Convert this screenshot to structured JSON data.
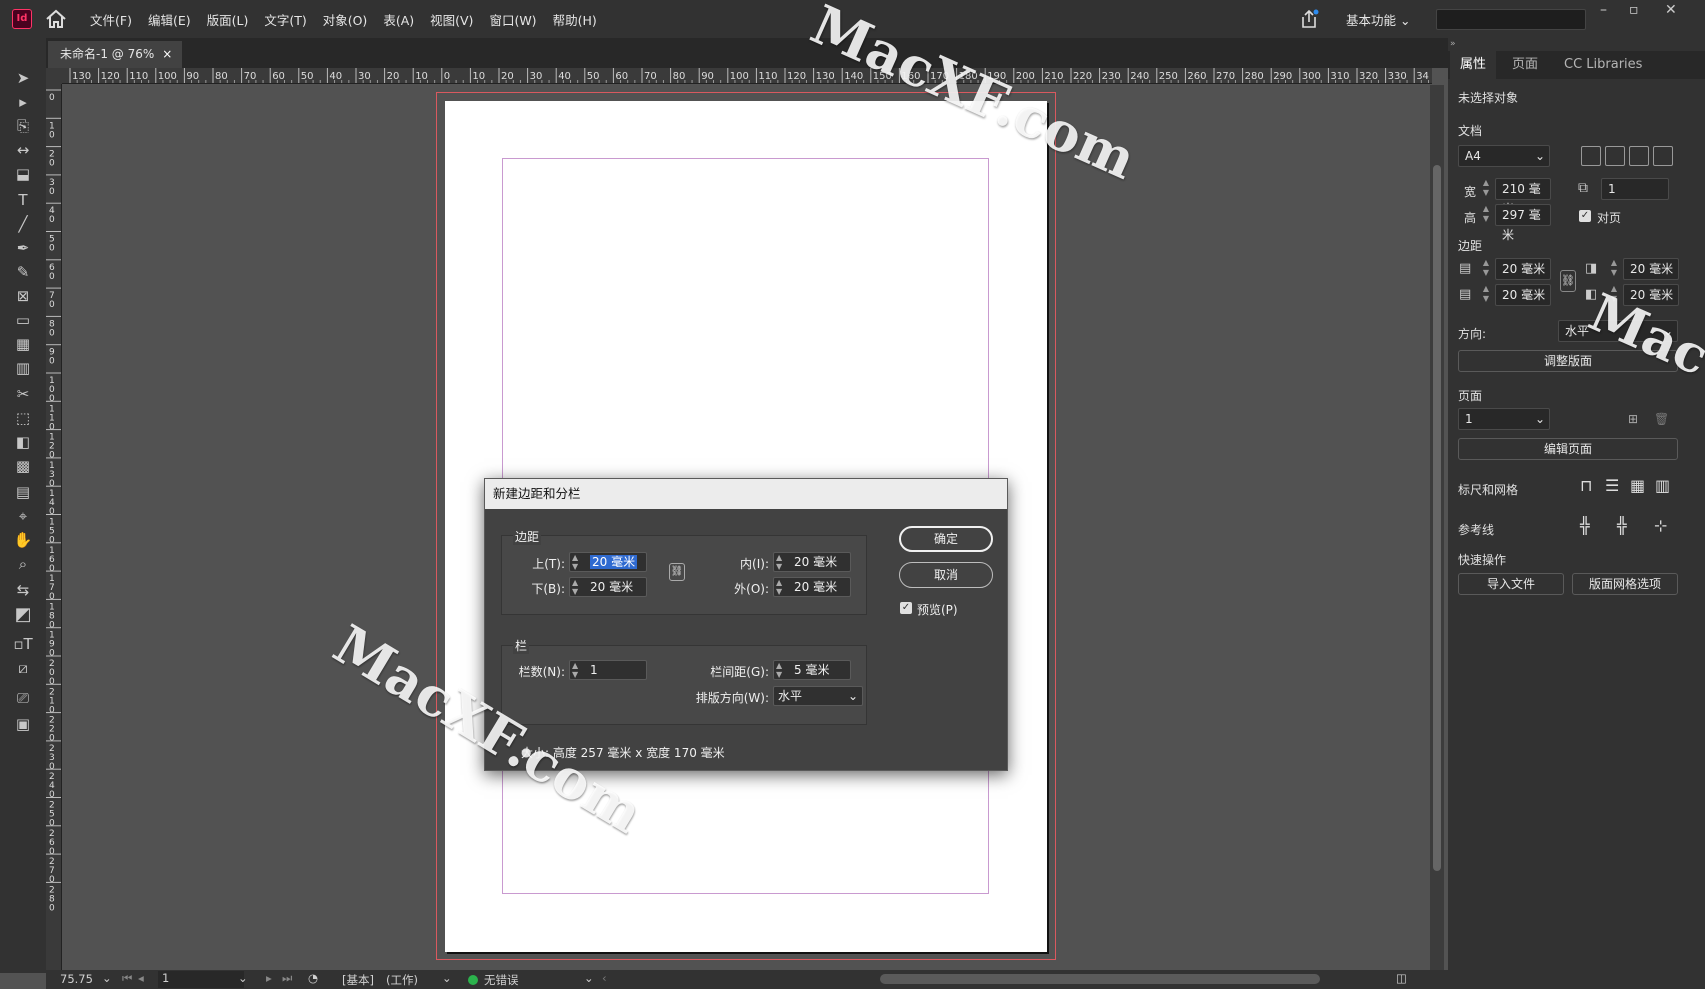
{
  "app": {
    "icon_label": "Id",
    "menu": [
      "文件(F)",
      "编辑(E)",
      "版面(L)",
      "文字(T)",
      "对象(O)",
      "表(A)",
      "视图(V)",
      "窗口(W)",
      "帮助(H)"
    ],
    "workspace": "基本功能"
  },
  "document": {
    "tab_title": "未命名-1 @ 76%",
    "close_glyph": "×"
  },
  "rulers": {
    "horizontal": [
      "130",
      "120",
      "110",
      "100",
      "90",
      "80",
      "70",
      "60",
      "50",
      "40",
      "30",
      "20",
      "10",
      "0",
      "10",
      "20",
      "30",
      "40",
      "50",
      "60",
      "70",
      "80",
      "90",
      "100",
      "110",
      "120",
      "130",
      "140",
      "150",
      "160",
      "170",
      "180",
      "190",
      "200",
      "210",
      "220",
      "230",
      "240",
      "250",
      "260",
      "270",
      "280",
      "290",
      "300",
      "310",
      "320",
      "330",
      "34"
    ],
    "vertical": [
      "0",
      "10",
      "20",
      "30",
      "40",
      "50",
      "60",
      "70",
      "80",
      "90",
      "100",
      "110",
      "120",
      "130",
      "140",
      "150",
      "160",
      "170",
      "180",
      "190",
      "200",
      "210",
      "220",
      "230",
      "240",
      "250",
      "260",
      "270",
      "280"
    ]
  },
  "status": {
    "zoom": "75.75",
    "page": "1",
    "style": "[基本]",
    "mode": "(工作)",
    "preflight": "无错误",
    "preflight_color": "#2bb24c"
  },
  "panel": {
    "tabs": [
      "属性",
      "页面",
      "CC Libraries"
    ],
    "selection": "未选择对象",
    "document_section": "文档",
    "preset": "A4",
    "width_label": "宽",
    "width": "210 毫米",
    "height_label": "高",
    "height": "297 毫米",
    "pages_count": "1",
    "facing_label": "对页",
    "margins_section": "边距",
    "margin_top": "20 毫米",
    "margin_bottom": "20 毫米",
    "margin_inside": "20 毫米",
    "margin_outside": "20 毫米",
    "orientation_label": "方向:",
    "orientation": "水平",
    "adjust_layout": "调整版面",
    "page_section": "页面",
    "current_page": "1",
    "edit_page": "编辑页面",
    "rulers_grids": "标尺和网格",
    "guides": "参考线",
    "quick_actions": "快速操作",
    "import_file": "导入文件",
    "layout_grid_options": "版面网格选项"
  },
  "dialog": {
    "title": "新建边距和分栏",
    "margins_group": "边距",
    "top_label": "上(T):",
    "top": "20 毫米",
    "bottom_label": "下(B):",
    "bottom": "20 毫米",
    "inside_label": "内(I):",
    "inside": "20 毫米",
    "outside_label": "外(O):",
    "outside": "20 毫米",
    "columns_group": "栏",
    "count_label": "栏数(N):",
    "count": "1",
    "gutter_label": "栏间距(G):",
    "gutter": "5 毫米",
    "direction_label": "排版方向(W):",
    "direction": "水平",
    "ok": "确定",
    "cancel": "取消",
    "preview": "预览(P)",
    "info": "大小: 高度 257 毫米 x 宽度 170 毫米"
  },
  "watermarks": [
    "MacXF.com",
    "MacXF.com",
    "Mac"
  ]
}
